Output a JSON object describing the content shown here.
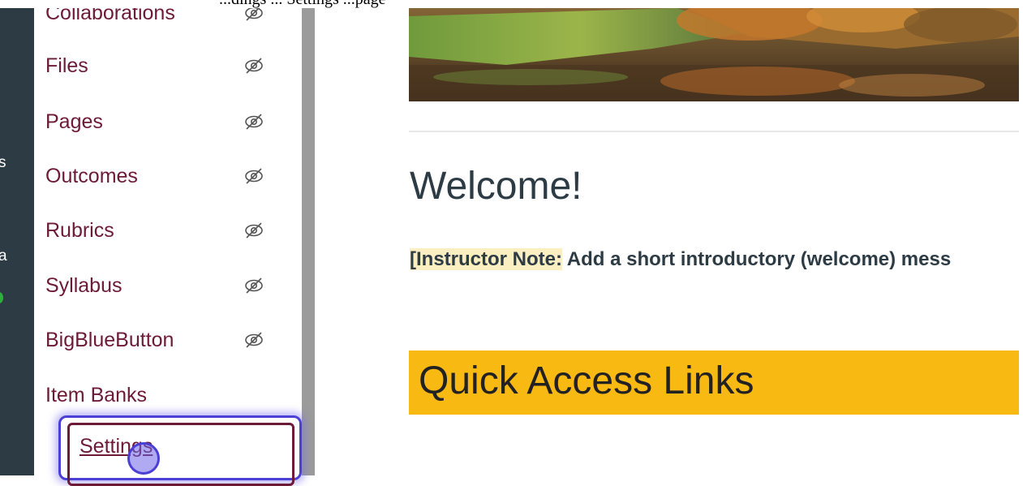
{
  "top_caption": "...dings ... Settings ...page",
  "global_nav": {
    "fragments": [
      "s",
      "a"
    ]
  },
  "course_nav": {
    "items": [
      {
        "label": "Collaborations",
        "hidden": true
      },
      {
        "label": "Files",
        "hidden": true
      },
      {
        "label": "Pages",
        "hidden": true
      },
      {
        "label": "Outcomes",
        "hidden": true
      },
      {
        "label": "Rubrics",
        "hidden": true
      },
      {
        "label": "Syllabus",
        "hidden": true
      },
      {
        "label": "BigBlueButton",
        "hidden": true
      },
      {
        "label": "Item Banks",
        "hidden": false
      },
      {
        "label": "Settings",
        "hidden": false,
        "active": true
      }
    ]
  },
  "main": {
    "welcome_heading": "Welcome!",
    "instructor_note_label": "[Instructor Note:",
    "instructor_note_text": " Add a short introductory (welcome) mess",
    "quick_links_heading": "Quick Access Links"
  },
  "colors": {
    "link": "#6c1a36",
    "highlight_yellow": "#f9b913",
    "focus_ring": "#4b3fd6",
    "global_nav_bg": "#2d3b45"
  }
}
